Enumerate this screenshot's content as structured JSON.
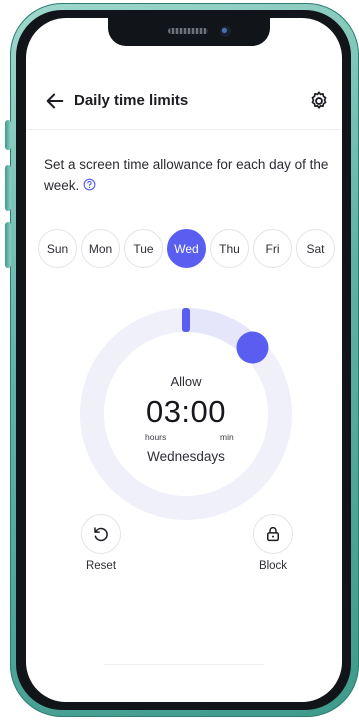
{
  "header": {
    "title": "Daily time limits",
    "back_icon": "arrow-left-icon",
    "settings_icon": "gear-icon"
  },
  "intro": {
    "text": "Set a screen time allowance for each day of the week.",
    "help_icon": "question-circle-icon"
  },
  "days": [
    {
      "label": "Sun",
      "selected": false
    },
    {
      "label": "Mon",
      "selected": false
    },
    {
      "label": "Tue",
      "selected": false
    },
    {
      "label": "Wed",
      "selected": true
    },
    {
      "label": "Thu",
      "selected": false
    },
    {
      "label": "Fri",
      "selected": false
    },
    {
      "label": "Sat",
      "selected": false
    }
  ],
  "dial": {
    "label": "Allow",
    "time": "03:00",
    "hours_unit": "hours",
    "minutes_unit": "min",
    "day": "Wednesdays",
    "progress_fraction": 0.125
  },
  "actions": {
    "reset": {
      "label": "Reset",
      "icon": "rotate-ccw-icon"
    },
    "block": {
      "label": "Block",
      "icon": "lock-icon"
    }
  },
  "colors": {
    "accent": "#5a5ef0",
    "track": "#eeeefd",
    "frame": "#5fb3a5"
  }
}
